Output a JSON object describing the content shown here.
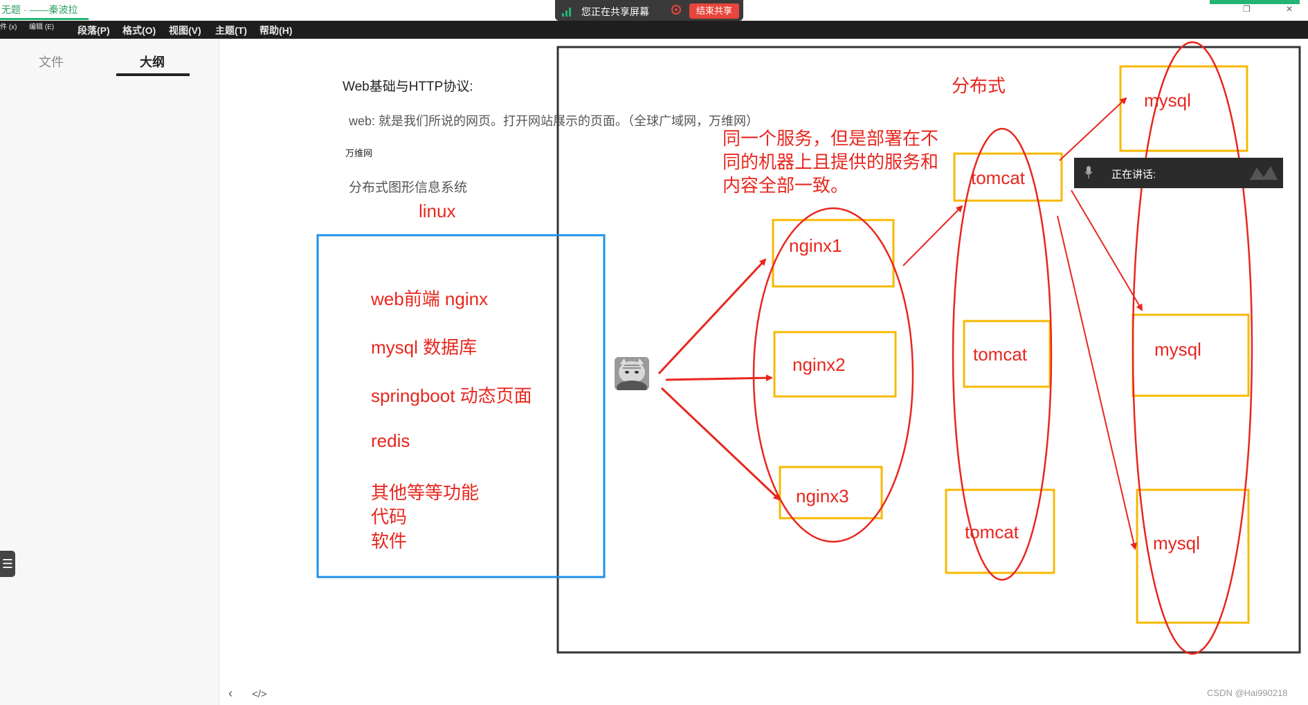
{
  "window": {
    "title": "无题 · ——秦波拉",
    "menu_small": [
      "件 (x)",
      "编辑 (E)"
    ],
    "menu": [
      "段落(P)",
      "格式(O)",
      "视图(V)",
      "主题(T)",
      "帮助(H)"
    ]
  },
  "share_bar": {
    "status": "您正在共享屏幕",
    "end_label": "结束共享"
  },
  "sidebar": {
    "tabs": [
      "文件",
      "大纲"
    ],
    "active_tab": "大纲"
  },
  "document": {
    "heading": "Web基础与HTTP协议:",
    "line1": "web: 就是我们所说的网页。打开网站展示的页面。（全球广域网，万维网）",
    "line2": "万维网",
    "line3": "分布式图形信息系统"
  },
  "annotations": {
    "linux": "linux",
    "box_items": [
      "web前端 nginx",
      "mysql  数据库",
      "springboot  动态页面",
      "redis",
      "其他等等功能",
      "代码",
      "软件"
    ],
    "distributed_title": "分布式",
    "distributed_desc": [
      "同一个服务，但是部署在不",
      "同的机器上且提供的服务和",
      "内容全部一致。"
    ],
    "nginx": [
      "nginx1",
      "nginx2",
      "nginx3"
    ],
    "tomcat": [
      "tomcat",
      "tomcat",
      "tomcat"
    ],
    "mysql": [
      "mysql",
      "mysql",
      "mysql"
    ]
  },
  "speaking": {
    "label": "正在讲话:"
  },
  "bottom": {
    "watermark": "CSDN @Hai990218"
  },
  "colors": {
    "red": "#e8261e",
    "orange": "#f7b800",
    "blue": "#1e90e8",
    "accent": "#22b573"
  }
}
